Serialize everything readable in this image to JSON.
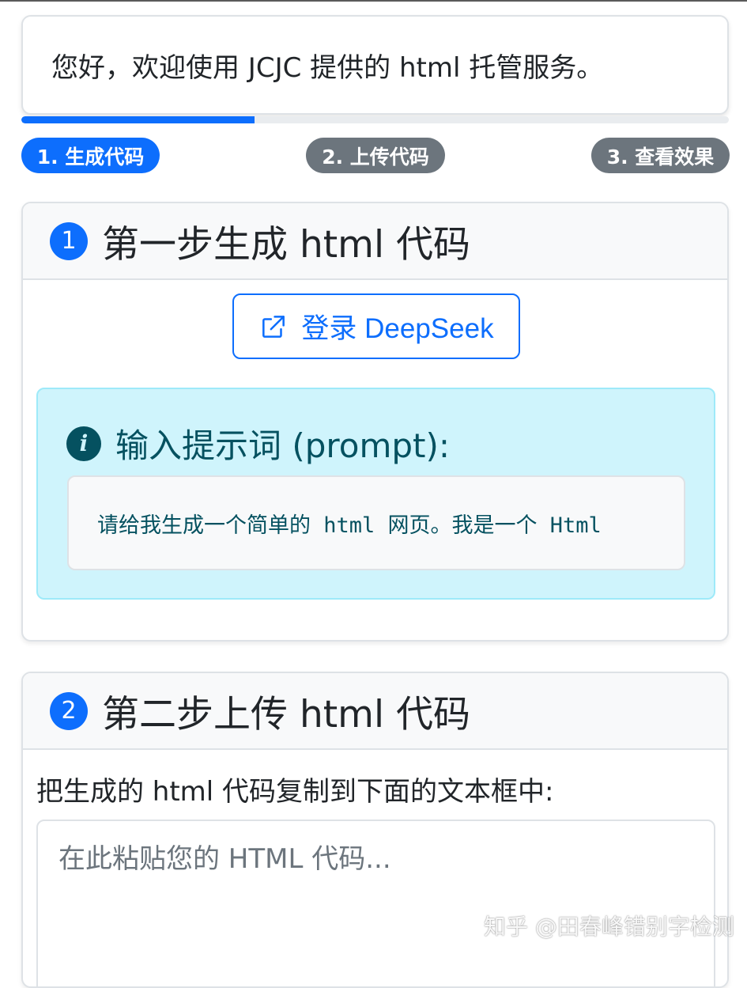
{
  "welcome": {
    "text": "您好，欢迎使用 JCJC 提供的 html 托管服务。"
  },
  "progress": {
    "percent": 33
  },
  "steps": [
    {
      "label": "1. 生成代码",
      "active": true
    },
    {
      "label": "2. 上传代码",
      "active": false
    },
    {
      "label": "3. 查看效果",
      "active": false
    }
  ],
  "card1": {
    "number": "1",
    "title": "第一步生成 html 代码",
    "login_button": "登录 DeepSeek",
    "info_heading": "输入提示词 (prompt):",
    "prompt_text": "请给我生成一个简单的 html 网页。我是一个 Html"
  },
  "card2": {
    "number": "2",
    "title": "第二步上传 html 代码",
    "instruction": "把生成的 html 代码复制到下面的文本框中:",
    "textarea_placeholder": "在此粘贴您的 HTML 代码..."
  },
  "watermark": "知乎 @田春峰错别字检测",
  "colors": {
    "primary": "#0d6efd",
    "secondary": "#6c757d",
    "info_bg": "#cff4fc",
    "info_text": "#055160"
  }
}
